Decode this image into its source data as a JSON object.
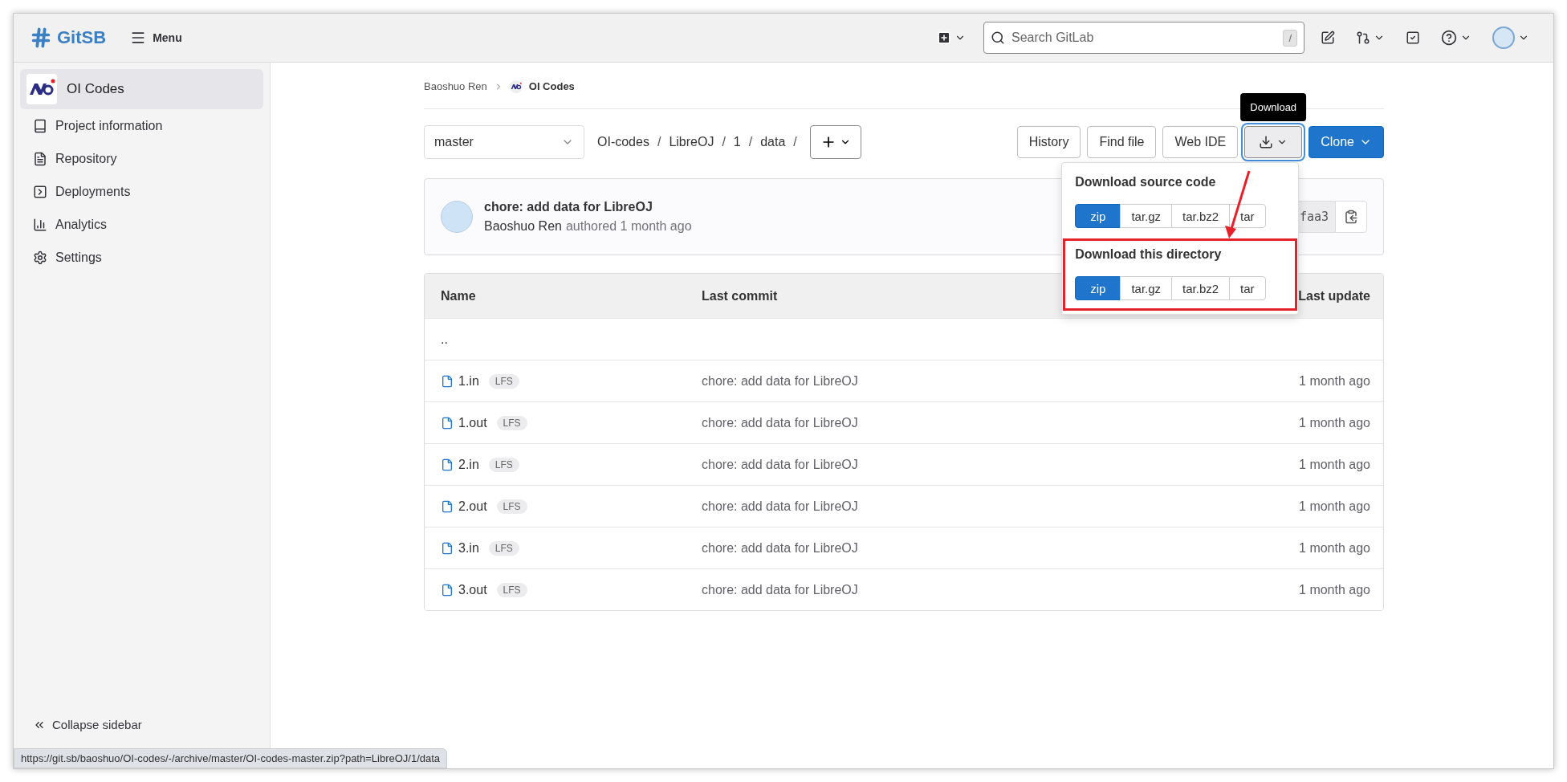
{
  "header": {
    "brand": "GitSB",
    "menu": "Menu",
    "search": {
      "placeholder": "Search GitLab",
      "shortcut": "/"
    }
  },
  "sidebar": {
    "project": "OI Codes",
    "items": [
      {
        "label": "Project information"
      },
      {
        "label": "Repository"
      },
      {
        "label": "Deployments"
      },
      {
        "label": "Analytics"
      },
      {
        "label": "Settings"
      }
    ],
    "collapse": "Collapse sidebar"
  },
  "breadcrumb": [
    "Baoshuo Ren",
    "OI Codes"
  ],
  "toolbar": {
    "branch": "master",
    "path": [
      "OI-codes",
      "LibreOJ",
      "1",
      "data"
    ],
    "separator": "/",
    "buttons": [
      "History",
      "Find file",
      "Web IDE"
    ],
    "clone": "Clone"
  },
  "tooltip": "Download",
  "download_menu": {
    "sections": [
      {
        "title": "Download source code",
        "highlighted": false,
        "formats": [
          {
            "label": "zip",
            "selected": true
          },
          {
            "label": "tar.gz",
            "selected": false
          },
          {
            "label": "tar.bz2",
            "selected": false
          },
          {
            "label": "tar",
            "selected": false
          }
        ]
      },
      {
        "title": "Download this directory",
        "highlighted": true,
        "formats": [
          {
            "label": "zip",
            "selected": true
          },
          {
            "label": "tar.gz",
            "selected": false
          },
          {
            "label": "tar.bz2",
            "selected": false
          },
          {
            "label": "tar",
            "selected": false
          }
        ]
      }
    ]
  },
  "commit": {
    "title": "chore: add data for LibreOJ",
    "author": "Baoshuo Ren",
    "action": "authored 1 month ago",
    "sha": "faa3"
  },
  "table": {
    "columns": [
      "Name",
      "Last commit",
      "Last update"
    ],
    "rows": [
      {
        "kind": "parent",
        "name": ".."
      },
      {
        "kind": "file",
        "name": "1.in",
        "badge": "LFS",
        "commit": "chore: add data for LibreOJ",
        "updated": "1 month ago"
      },
      {
        "kind": "file",
        "name": "1.out",
        "badge": "LFS",
        "commit": "chore: add data for LibreOJ",
        "updated": "1 month ago"
      },
      {
        "kind": "file",
        "name": "2.in",
        "badge": "LFS",
        "commit": "chore: add data for LibreOJ",
        "updated": "1 month ago"
      },
      {
        "kind": "file",
        "name": "2.out",
        "badge": "LFS",
        "commit": "chore: add data for LibreOJ",
        "updated": "1 month ago"
      },
      {
        "kind": "file",
        "name": "3.in",
        "badge": "LFS",
        "commit": "chore: add data for LibreOJ",
        "updated": "1 month ago"
      },
      {
        "kind": "file",
        "name": "3.out",
        "badge": "LFS",
        "commit": "chore: add data for LibreOJ",
        "updated": "1 month ago"
      }
    ]
  },
  "status_bar": "https://git.sb/baoshuo/OI-codes/-/archive/master/OI-codes-master.zip?path=LibreOJ/1/data"
}
